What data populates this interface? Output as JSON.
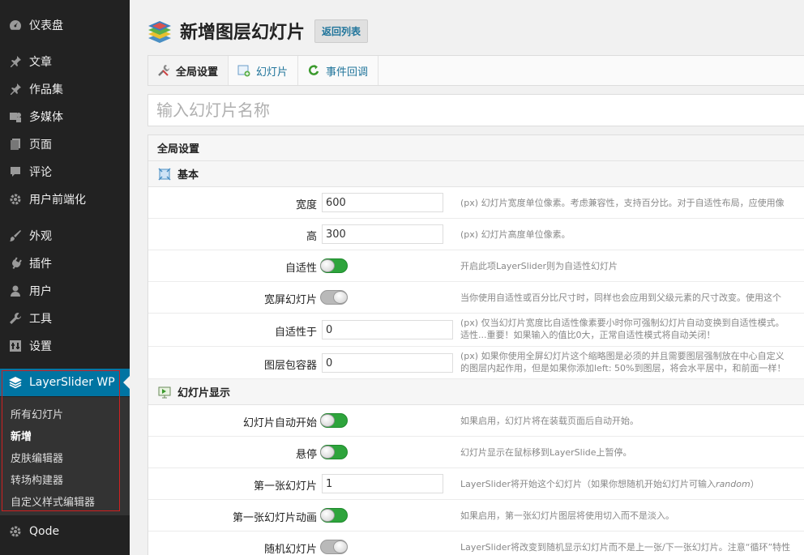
{
  "sidebar": {
    "items": [
      {
        "label": "仪表盘",
        "icon": "dashboard-icon"
      },
      {
        "label": "文章",
        "icon": "pin-icon"
      },
      {
        "label": "作品集",
        "icon": "pin-icon"
      },
      {
        "label": "多媒体",
        "icon": "media-icon"
      },
      {
        "label": "页面",
        "icon": "page-icon"
      },
      {
        "label": "评论",
        "icon": "comment-icon"
      },
      {
        "label": "用户前端化",
        "icon": "gear-icon"
      },
      {
        "label": "外观",
        "icon": "brush-icon"
      },
      {
        "label": "插件",
        "icon": "plugin-icon"
      },
      {
        "label": "用户",
        "icon": "user-icon"
      },
      {
        "label": "工具",
        "icon": "wrench-icon"
      },
      {
        "label": "设置",
        "icon": "settings-icon"
      },
      {
        "label": "LayerSlider WP",
        "icon": "layerslider-icon"
      },
      {
        "label": "Qode",
        "icon": "gear-icon"
      }
    ],
    "submenu": [
      {
        "label": "所有幻灯片"
      },
      {
        "label": "新增"
      },
      {
        "label": "皮肤编辑器"
      },
      {
        "label": "转场构建器"
      },
      {
        "label": "自定义样式编辑器"
      }
    ]
  },
  "header": {
    "title": "新增图层幻灯片",
    "back_label": "返回列表"
  },
  "tabs": [
    {
      "label": "全局设置"
    },
    {
      "label": "幻灯片"
    },
    {
      "label": "事件回调"
    }
  ],
  "name_input": {
    "placeholder": "输入幻灯片名称",
    "value": ""
  },
  "panel": {
    "title": "全局设置",
    "section_basic": "基本",
    "section_display": "幻灯片显示",
    "rows": {
      "width": {
        "label": "宽度",
        "value": "600",
        "desc": "(px) 幻灯片宽度单位像素。考虑兼容性，支持百分比。对于自适性布局，应使用像"
      },
      "height": {
        "label": "高",
        "value": "300",
        "desc": "(px) 幻灯片高度单位像素。"
      },
      "responsive": {
        "label": "自适性",
        "on": true,
        "desc": "开启此项LayerSlider则为自适性幻灯片"
      },
      "fullwidth": {
        "label": "宽屏幻灯片",
        "on": false,
        "desc": "当你使用自适性或百分比尺寸时，同样也会应用到父级元素的尺寸改变。使用这个"
      },
      "responsive_under": {
        "label": "自适性于",
        "value": "0",
        "desc1": "(px) 仅当幻灯片宽度比自适性像素要小时你可强制幻灯片自动变换到自适性模式。",
        "desc2": "适性...重要！如果输入的值比0大，正常自适性模式将自动关闭！"
      },
      "layers_container": {
        "label": "图层包容器",
        "value": "0",
        "desc1": "(px) 如果你使用全屏幻灯片这个缩略图是必须的并且需要图层强制放在中心自定义",
        "desc2": "的图层内起作用，但是如果你添加left: 50%到图层，将会水平居中，和前面一样！"
      },
      "autostart": {
        "label": "幻灯片自动开始",
        "on": true,
        "desc": "如果启用，幻灯片将在装载页面后自动开始。"
      },
      "pause_on_hover": {
        "label": "悬停",
        "on": true,
        "desc": "幻灯片显示在鼠标移到LayerSlide上暂停。"
      },
      "first_slide": {
        "label": "第一张幻灯片",
        "value": "1",
        "desc_a": "LayerSlider将开始这个幻灯片（如果你想随机开始幻灯片可输入",
        "desc_em": "random",
        "desc_b": "）"
      },
      "first_slide_anim": {
        "label": "第一张幻灯片动画",
        "on": true,
        "desc": "如果启用，第一张幻灯片图层将使用切入而不是淡入。"
      },
      "random_slideshow": {
        "label": "随机幻灯片",
        "on": false,
        "desc": "LayerSlider将改变到随机显示幻灯片而不是上一张/下一张幻灯片。注意“循环”特性"
      }
    }
  }
}
